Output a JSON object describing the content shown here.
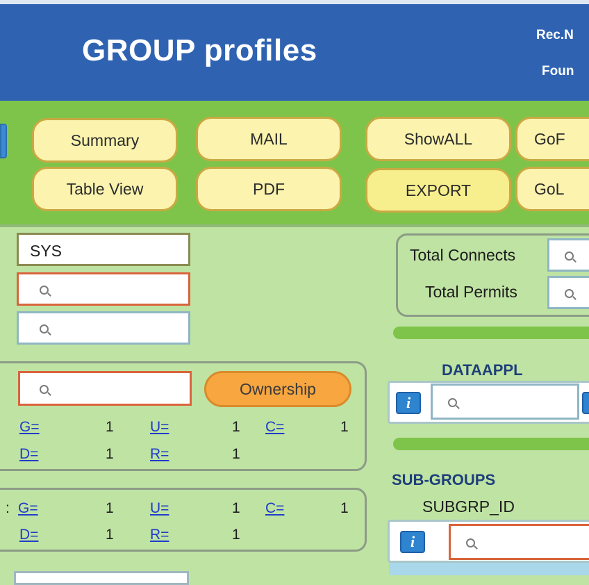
{
  "header": {
    "title": "GROUP profiles",
    "rec_label": "Rec.N",
    "found_label": "Foun"
  },
  "toolbar": {
    "summary": "Summary",
    "mail": "MAIL",
    "showall": "ShowALL",
    "gof": "GoF",
    "table_view": "Table View",
    "pdf": "PDF",
    "export": "EXPORT",
    "gol": "GoL"
  },
  "filters": {
    "group_value": "SYS"
  },
  "ownership": {
    "button": "Ownership"
  },
  "stats1": {
    "g_label": "G=",
    "g_val": "1",
    "u_label": "U=",
    "u_val": "1",
    "c_label": "C=",
    "c_val": "1",
    "d_label": "D=",
    "d_val": "1",
    "r_label": "R=",
    "r_val": "1"
  },
  "stats2": {
    "prefix": ":",
    "g_label": "G=",
    "g_val": "1",
    "u_label": "U=",
    "u_val": "1",
    "c_label": "C=",
    "c_val": "1",
    "d_label": "D=",
    "d_val": "1",
    "r_label": "R=",
    "r_val": "1"
  },
  "totals": {
    "connects_label": "Total Connects",
    "permits_label": "Total Permits"
  },
  "dataappl": {
    "header": "DATAAPPL",
    "info": "i"
  },
  "subgroups": {
    "header": "SUB-GROUPS",
    "column": "SUBGRP_ID",
    "info": "i"
  },
  "colors": {
    "header_bg": "#2f63b2",
    "toolbar_bg": "#7fc44a",
    "body_bg": "#bfe3a3",
    "button_bg": "#fbf3ae",
    "ownership_bg": "#f7a640",
    "link": "#1f3cc9"
  }
}
